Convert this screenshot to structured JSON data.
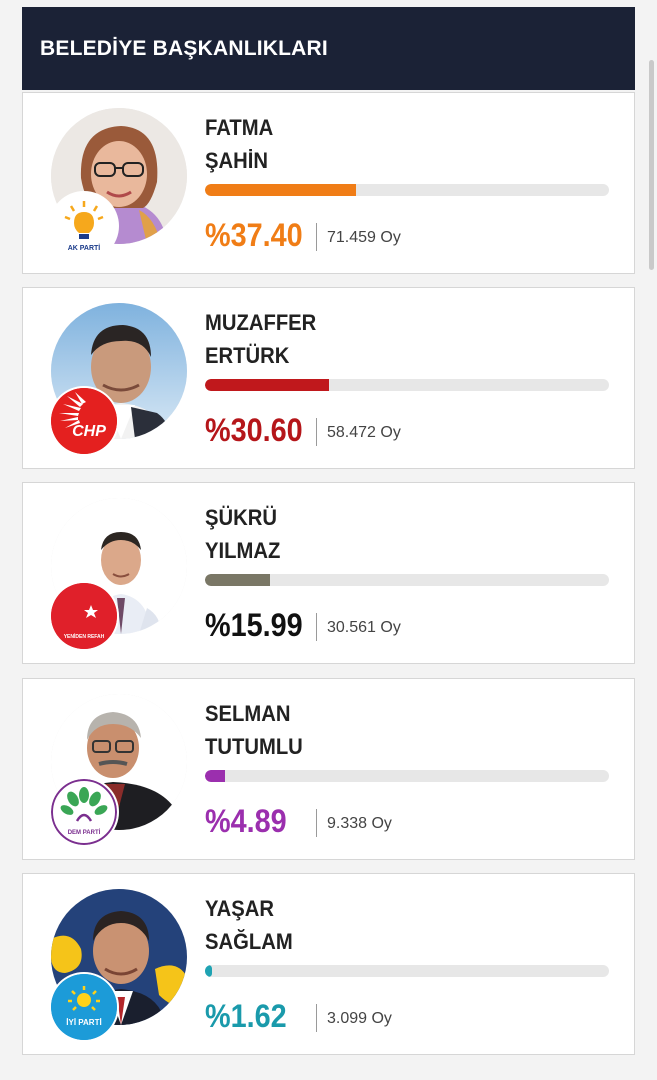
{
  "header": {
    "title": "BELEDİYE BAŞKANLIKLARI"
  },
  "candidates": [
    {
      "first": "FATMA",
      "last": "ŞAHİN",
      "percent_label": "%37.40",
      "percent": 37.4,
      "votes": "71.459 Oy",
      "color": "#f07d16",
      "party_logo": "ak-parti-logo",
      "logo_text": "AK PARTİ"
    },
    {
      "first": "MUZAFFER",
      "last": "ERTÜRK",
      "percent_label": "%30.60",
      "percent": 30.6,
      "votes": "58.472 Oy",
      "color": "#c0181c",
      "party_logo": "chp-logo",
      "logo_text": "CHP"
    },
    {
      "first": "ŞÜKRÜ",
      "last": "YILMAZ",
      "percent_label": "%15.99",
      "percent": 15.99,
      "votes": "30.561 Oy",
      "color": "#7a7766",
      "party_logo": "yeniden-refah-logo",
      "logo_text": "YENİDEN REFAH"
    },
    {
      "first": "SELMAN",
      "last": "TUTUMLU",
      "percent_label": "%4.89",
      "percent": 4.89,
      "votes": "9.338 Oy",
      "color": "#9b2fae",
      "party_logo": "dem-parti-logo",
      "logo_text": "DEM PARTİ"
    },
    {
      "first": "YAŞAR",
      "last": "SAĞLAM",
      "percent_label": "%1.62",
      "percent": 1.62,
      "votes": "3.099 Oy",
      "color": "#1fa3b3",
      "party_logo": "iyi-parti-logo",
      "logo_text": "İYİ PARTİ"
    }
  ],
  "text_colors": [
    "#f07d16",
    "#b5161a",
    "#111111",
    "#9b2fae",
    "#1a9aab"
  ]
}
